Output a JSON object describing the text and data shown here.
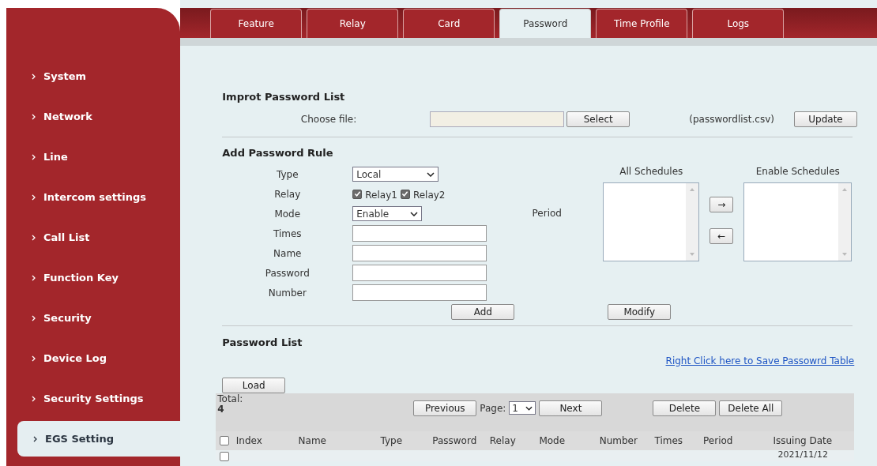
{
  "sidebar": {
    "items": [
      {
        "label": "System",
        "selected": false
      },
      {
        "label": "Network",
        "selected": false
      },
      {
        "label": "Line",
        "selected": false
      },
      {
        "label": "Intercom settings",
        "selected": false
      },
      {
        "label": "Call List",
        "selected": false
      },
      {
        "label": "Function Key",
        "selected": false
      },
      {
        "label": "Security",
        "selected": false
      },
      {
        "label": "Device Log",
        "selected": false
      },
      {
        "label": "Security Settings",
        "selected": false
      },
      {
        "label": "EGS Setting",
        "selected": true
      }
    ]
  },
  "tabs": [
    {
      "label": "Feature",
      "selected": false
    },
    {
      "label": "Relay",
      "selected": false
    },
    {
      "label": "Card",
      "selected": false
    },
    {
      "label": "Password",
      "selected": true
    },
    {
      "label": "Time Profile",
      "selected": false
    },
    {
      "label": "Logs",
      "selected": false
    }
  ],
  "import": {
    "heading": "Improt Password List",
    "choose_label": "Choose file:",
    "select_button": "Select",
    "file_hint": "(passwordlist.csv)",
    "update_button": "Update"
  },
  "rule": {
    "heading": "Add Password Rule",
    "fields": [
      {
        "label": "Type",
        "kind": "select",
        "value": "Local"
      },
      {
        "label": "Relay",
        "kind": "checkboxes",
        "options": [
          {
            "label": "Relay1",
            "checked": true
          },
          {
            "label": "Relay2",
            "checked": true
          }
        ]
      },
      {
        "label": "Mode",
        "kind": "select",
        "value": "Enable"
      },
      {
        "label": "Times",
        "kind": "text"
      },
      {
        "label": "Name",
        "kind": "text"
      },
      {
        "label": "Password",
        "kind": "text"
      },
      {
        "label": "Number",
        "kind": "text"
      }
    ],
    "period_label": "Period",
    "all_schedules_label": "All Schedules",
    "enable_schedules_label": "Enable Schedules",
    "move_right_button": "→",
    "move_left_button": "←",
    "add_button": "Add",
    "modify_button": "Modify"
  },
  "list": {
    "heading": "Password List",
    "save_link": "Right Click here to Save Passowrd Table",
    "load_button": "Load",
    "total_label": "Total:",
    "total_value": "4",
    "previous_button": "Previous",
    "page_label": "Page:",
    "page_value": "1",
    "next_button": "Next",
    "delete_button": "Delete",
    "delete_all_button": "Delete All",
    "select_all_checked": false,
    "columns": [
      "Index",
      "Name",
      "Type",
      "Password",
      "Relay",
      "Mode",
      "Number",
      "Times",
      "Period",
      "Issuing Date"
    ],
    "rows": [
      {
        "checked": false,
        "issuing_date": "2021/11/12"
      }
    ]
  }
}
